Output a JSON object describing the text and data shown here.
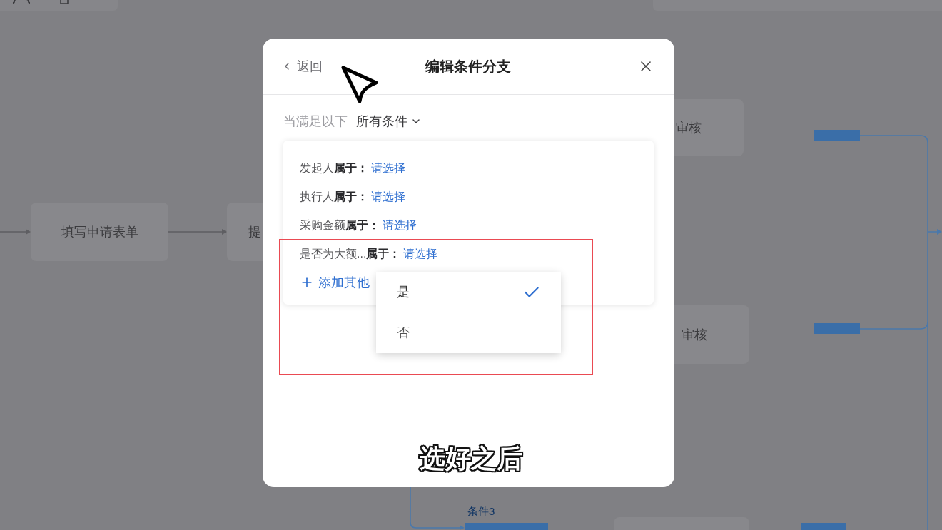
{
  "flow_canvas": {
    "nodes": [
      {
        "label": "填写申请表单"
      },
      {
        "label": "提"
      },
      {
        "label": "审核"
      },
      {
        "label": "审核"
      }
    ],
    "branch_label": "条件3"
  },
  "dialog": {
    "back": {
      "label": "返回"
    },
    "title": "编辑条件分支",
    "match_rule": {
      "prefix": "当满足以下",
      "mode": "所有条件"
    },
    "conditions": [
      {
        "field": "发起人",
        "operator": "属于：",
        "value": "请选择"
      },
      {
        "field": "执行人",
        "operator": "属于：",
        "value": "请选择"
      },
      {
        "field": "采购金额",
        "operator": "属于：",
        "value": "请选择"
      },
      {
        "field": "是否为大额...",
        "operator": "属于：",
        "value": "请选择"
      }
    ],
    "add_button": {
      "label": "添加其他"
    },
    "dropdown": {
      "options": [
        {
          "label": "是",
          "selected": true
        },
        {
          "label": "否",
          "selected": false
        }
      ]
    }
  },
  "subtitle": "选好之后"
}
